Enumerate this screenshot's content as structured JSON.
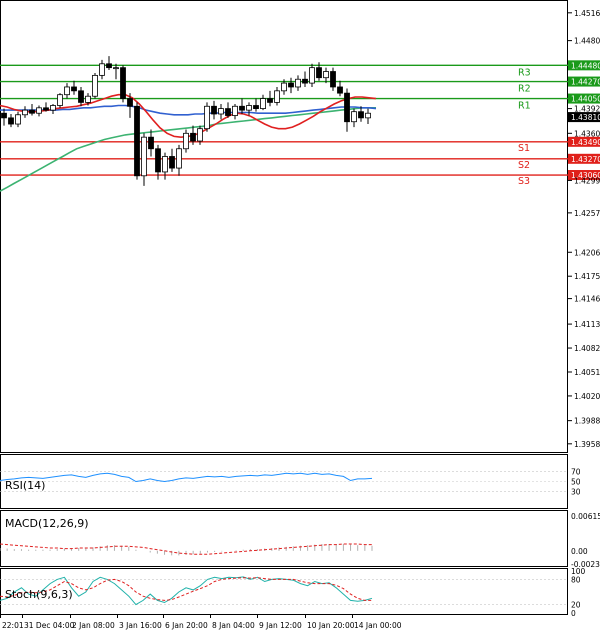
{
  "chart_data": {
    "type": "candlestick",
    "main": {
      "ylim": [
        1.395,
        1.453
      ],
      "price_ticks": [
        "1.45160",
        "1.44800",
        "1.44480",
        "1.44270",
        "1.44050",
        "1.43920",
        "1.43810",
        "1.43600",
        "1.43490",
        "1.43270",
        "1.43060",
        "1.42990",
        "1.42570",
        "1.42060",
        "1.41750",
        "1.41460",
        "1.41130",
        "1.40820",
        "1.40510",
        "1.40200",
        "1.39880",
        "1.39580"
      ],
      "current_price": "1.43810",
      "levels": [
        {
          "name": "R3",
          "value": 1.4448,
          "label": "1.44480",
          "color": "#1a9a1a"
        },
        {
          "name": "R2",
          "value": 1.4427,
          "label": "1.44270",
          "color": "#1a9a1a"
        },
        {
          "name": "R1",
          "value": 1.4405,
          "label": "1.44050",
          "color": "#1a9a1a"
        },
        {
          "name": "S1",
          "value": 1.4349,
          "label": "1.43490",
          "color": "#e0201a"
        },
        {
          "name": "S2",
          "value": 1.4327,
          "label": "1.43270",
          "color": "#e0201a"
        },
        {
          "name": "S3",
          "value": 1.4306,
          "label": "1.43060",
          "color": "#e0201a"
        }
      ],
      "ma_fast": [
        1.4396,
        1.4394,
        1.4391,
        1.4389,
        1.4388,
        1.4388,
        1.4389,
        1.439,
        1.4392,
        1.4393,
        1.4394,
        1.4395,
        1.4397,
        1.4399,
        1.4402,
        1.4405,
        1.4408,
        1.441,
        1.441,
        1.4406,
        1.4398,
        1.4388,
        1.4377,
        1.4367,
        1.436,
        1.4356,
        1.4355,
        1.4356,
        1.4358,
        1.4362,
        1.4367,
        1.4372,
        1.4378,
        1.4383,
        1.4386,
        1.4385,
        1.4382,
        1.4377,
        1.4372,
        1.4368,
        1.4366,
        1.4366,
        1.4368,
        1.4372,
        1.4377,
        1.4382,
        1.4388,
        1.4393,
        1.4398,
        1.4402,
        1.4405,
        1.4407,
        1.4407,
        1.4406,
        1.4405
      ],
      "ma_mid": [
        1.439,
        1.439,
        1.439,
        1.439,
        1.439,
        1.439,
        1.439,
        1.439,
        1.439,
        1.4391,
        1.4391,
        1.4392,
        1.4393,
        1.4393,
        1.4394,
        1.4395,
        1.4395,
        1.4396,
        1.4396,
        1.4395,
        1.4393,
        1.439,
        1.4388,
        1.4386,
        1.4385,
        1.4384,
        1.4384,
        1.4384,
        1.4385,
        1.4385,
        1.4386,
        1.4386,
        1.4387,
        1.4387,
        1.4387,
        1.4387,
        1.4387,
        1.4386,
        1.4386,
        1.4386,
        1.4386,
        1.4386,
        1.4387,
        1.4388,
        1.4389,
        1.439,
        1.4391,
        1.4392,
        1.4393,
        1.4394,
        1.4394,
        1.4394,
        1.4393,
        1.4393,
        1.4392
      ],
      "ma_slow": [
        1.4285,
        1.429,
        1.4295,
        1.43,
        1.4305,
        1.431,
        1.4315,
        1.432,
        1.4325,
        1.433,
        1.4335,
        1.434,
        1.4343,
        1.4346,
        1.4349,
        1.4352,
        1.4354,
        1.4356,
        1.4358,
        1.4359,
        1.436,
        1.4361,
        1.4362,
        1.4363,
        1.4364,
        1.4365,
        1.4366,
        1.4367,
        1.4368,
        1.4369,
        1.437,
        1.4372,
        1.4373,
        1.4374,
        1.4375,
        1.4376,
        1.4377,
        1.4378,
        1.4379,
        1.438,
        1.4381,
        1.4382,
        1.4383,
        1.4384,
        1.4385,
        1.4386,
        1.4387,
        1.4388,
        1.4389,
        1.439,
        1.4391,
        1.4392,
        1.4393,
        1.4393,
        1.4393
      ],
      "candles": [
        [
          1.4386,
          1.4392,
          1.437,
          1.438
        ],
        [
          1.438,
          1.4385,
          1.4368,
          1.4372
        ],
        [
          1.4372,
          1.4388,
          1.4368,
          1.4384
        ],
        [
          1.4384,
          1.4395,
          1.438,
          1.439
        ],
        [
          1.439,
          1.4398,
          1.4383,
          1.4386
        ],
        [
          1.4386,
          1.4396,
          1.4382,
          1.4393
        ],
        [
          1.4393,
          1.44,
          1.4388,
          1.439
        ],
        [
          1.439,
          1.4398,
          1.4385,
          1.4396
        ],
        [
          1.4396,
          1.4412,
          1.4393,
          1.441
        ],
        [
          1.441,
          1.4425,
          1.4405,
          1.442
        ],
        [
          1.442,
          1.4428,
          1.441,
          1.4415
        ],
        [
          1.4415,
          1.442,
          1.4395,
          1.44
        ],
        [
          1.44,
          1.4412,
          1.4396,
          1.4408
        ],
        [
          1.4408,
          1.4438,
          1.4405,
          1.4435
        ],
        [
          1.4435,
          1.4455,
          1.443,
          1.445
        ],
        [
          1.445,
          1.446,
          1.4442,
          1.4445
        ],
        [
          1.4445,
          1.445,
          1.443,
          1.4445
        ],
        [
          1.4445,
          1.4448,
          1.44,
          1.4405
        ],
        [
          1.4405,
          1.4412,
          1.438,
          1.4395
        ],
        [
          1.4395,
          1.44,
          1.43,
          1.4305
        ],
        [
          1.4305,
          1.436,
          1.4292,
          1.4355
        ],
        [
          1.4355,
          1.4365,
          1.433,
          1.434
        ],
        [
          1.434,
          1.4345,
          1.43,
          1.431
        ],
        [
          1.431,
          1.4335,
          1.43,
          1.433
        ],
        [
          1.433,
          1.434,
          1.431,
          1.4315
        ],
        [
          1.4315,
          1.4345,
          1.4305,
          1.434
        ],
        [
          1.434,
          1.4365,
          1.4335,
          1.436
        ],
        [
          1.436,
          1.437,
          1.4345,
          1.435
        ],
        [
          1.435,
          1.437,
          1.4345,
          1.4366
        ],
        [
          1.4366,
          1.44,
          1.4362,
          1.4395
        ],
        [
          1.4395,
          1.4402,
          1.4378,
          1.4385
        ],
        [
          1.4385,
          1.4398,
          1.4378,
          1.4392
        ],
        [
          1.4392,
          1.44,
          1.438,
          1.4383
        ],
        [
          1.4383,
          1.4398,
          1.4378,
          1.4395
        ],
        [
          1.4395,
          1.4405,
          1.4385,
          1.439
        ],
        [
          1.439,
          1.44,
          1.4383,
          1.4396
        ],
        [
          1.4396,
          1.4405,
          1.4388,
          1.4392
        ],
        [
          1.4392,
          1.441,
          1.439,
          1.4405
        ],
        [
          1.4405,
          1.4415,
          1.4395,
          1.44
        ],
        [
          1.44,
          1.442,
          1.4396,
          1.4415
        ],
        [
          1.4415,
          1.443,
          1.441,
          1.4425
        ],
        [
          1.4425,
          1.4432,
          1.4412,
          1.442
        ],
        [
          1.442,
          1.4435,
          1.4415,
          1.443
        ],
        [
          1.443,
          1.444,
          1.442,
          1.4425
        ],
        [
          1.4425,
          1.445,
          1.442,
          1.4445
        ],
        [
          1.4445,
          1.4452,
          1.4428,
          1.4432
        ],
        [
          1.4432,
          1.4445,
          1.4425,
          1.444
        ],
        [
          1.444,
          1.4445,
          1.4415,
          1.442
        ],
        [
          1.442,
          1.4428,
          1.4408,
          1.4412
        ],
        [
          1.4412,
          1.4418,
          1.4362,
          1.4375
        ],
        [
          1.4375,
          1.4392,
          1.4368,
          1.4388
        ],
        [
          1.4388,
          1.4395,
          1.4375,
          1.438
        ],
        [
          1.438,
          1.4392,
          1.4372,
          1.4386
        ]
      ]
    },
    "rsi": {
      "label": "RSI(14)",
      "ticks": [
        "70",
        "50",
        "30"
      ],
      "ylim": [
        0,
        100
      ],
      "values": [
        52,
        54,
        55,
        57,
        58,
        57,
        56,
        58,
        60,
        62,
        63,
        60,
        58,
        62,
        65,
        66,
        64,
        60,
        58,
        50,
        52,
        55,
        52,
        50,
        52,
        55,
        57,
        56,
        58,
        60,
        59,
        60,
        58,
        60,
        61,
        62,
        61,
        63,
        62,
        64,
        66,
        65,
        66,
        64,
        66,
        64,
        65,
        62,
        60,
        52,
        55,
        55,
        56
      ]
    },
    "macd": {
      "label": "MACD(12,26,9)",
      "ticks": [
        "0.006151",
        "0.00",
        "-0.002318"
      ],
      "ylim": [
        -0.0025,
        0.0065
      ],
      "hist": [
        0.0005,
        0.0004,
        0.0003,
        0.0003,
        0.0002,
        0.0002,
        0.0002,
        0.0002,
        0.0003,
        0.0004,
        0.0005,
        0.0005,
        0.0004,
        0.0006,
        0.0008,
        0.001,
        0.001,
        0.0009,
        0.0007,
        0.0002,
        0.0,
        -0.0003,
        -0.0005,
        -0.0007,
        -0.0008,
        -0.0008,
        -0.0007,
        -0.0006,
        -0.0005,
        -0.0003,
        -0.0002,
        -0.0001,
        0.0,
        0.0001,
        0.0002,
        0.0003,
        0.0003,
        0.0004,
        0.0005,
        0.0006,
        0.0007,
        0.0008,
        0.0009,
        0.001,
        0.0011,
        0.0012,
        0.0012,
        0.0012,
        0.0012,
        0.0011,
        0.001,
        0.001,
        0.0009
      ],
      "signal": [
        0.0012,
        0.0011,
        0.001,
        0.0009,
        0.0008,
        0.0007,
        0.0006,
        0.0005,
        0.0005,
        0.0004,
        0.0004,
        0.0005,
        0.0005,
        0.0005,
        0.0006,
        0.0007,
        0.0008,
        0.0008,
        0.0008,
        0.0007,
        0.0006,
        0.0004,
        0.0002,
        0.0,
        -0.0002,
        -0.0004,
        -0.0005,
        -0.0006,
        -0.0006,
        -0.0006,
        -0.0005,
        -0.0004,
        -0.0003,
        -0.0002,
        -0.0001,
        0.0,
        0.0001,
        0.0002,
        0.0003,
        0.0004,
        0.0005,
        0.0006,
        0.0007,
        0.0008,
        0.0009,
        0.001,
        0.0011,
        0.0011,
        0.0012,
        0.0012,
        0.0012,
        0.0011,
        0.0011
      ]
    },
    "stoch": {
      "label": "Stoch(9,6,3)",
      "ticks": [
        "100",
        "80",
        "20",
        "0"
      ],
      "ylim": [
        0,
        100
      ],
      "k": [
        30,
        35,
        50,
        60,
        45,
        40,
        55,
        70,
        80,
        85,
        60,
        40,
        50,
        75,
        85,
        80,
        70,
        55,
        40,
        20,
        30,
        45,
        30,
        25,
        35,
        50,
        60,
        55,
        65,
        80,
        85,
        82,
        85,
        84,
        86,
        80,
        85,
        75,
        80,
        82,
        80,
        78,
        70,
        65,
        75,
        70,
        72,
        60,
        45,
        30,
        28,
        30,
        35
      ],
      "d": [
        40,
        38,
        42,
        48,
        50,
        48,
        50,
        55,
        65,
        75,
        70,
        60,
        55,
        60,
        70,
        78,
        80,
        75,
        65,
        50,
        40,
        35,
        32,
        30,
        32,
        38,
        45,
        52,
        58,
        65,
        75,
        80,
        82,
        83,
        84,
        83,
        84,
        82,
        80,
        80,
        80,
        80,
        76,
        72,
        70,
        70,
        70,
        66,
        58,
        45,
        35,
        30,
        30
      ]
    },
    "x_labels": [
      "22:01",
      "31 Dec 04:00",
      "2 Jan 08:00",
      "3 Jan 16:00",
      "6 Jan 20:00",
      "8 Jan 04:00",
      "9 Jan 12:00",
      "10 Jan 20:00",
      "14 Jan 00:00"
    ]
  }
}
